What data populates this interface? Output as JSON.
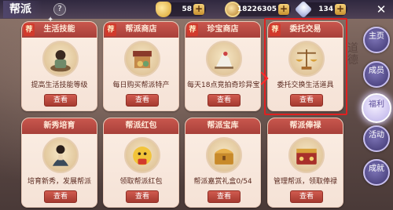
{
  "header": {
    "title": "帮派",
    "help": "?",
    "close": "✕"
  },
  "resources": [
    {
      "name": "gold-ingot",
      "value": "58",
      "plus": "+"
    },
    {
      "name": "coin",
      "value": "18226305",
      "plus": "+"
    },
    {
      "name": "gem",
      "value": "134",
      "plus": "+"
    }
  ],
  "cards": [
    {
      "title": "生活技能",
      "desc": "提高生活技能等级",
      "button": "查看",
      "recommended": "荐"
    },
    {
      "title": "帮派商店",
      "desc": "每日购买帮派特产",
      "button": "查看",
      "recommended": "荐"
    },
    {
      "title": "珍宝商店",
      "desc": "每天18点竞拍奇珍异宝",
      "button": "查看",
      "recommended": "荐"
    },
    {
      "title": "委托交易",
      "desc": "委托交换生活道具",
      "button": "查看",
      "recommended": "荐"
    },
    {
      "title": "新秀培育",
      "desc": "培育新秀，发展帮派",
      "button": "查看",
      "recommended": ""
    },
    {
      "title": "帮派红包",
      "desc": "领取帮派红包",
      "button": "查看",
      "recommended": ""
    },
    {
      "title": "帮派宝库",
      "desc": "帮派嘉赏礼盒0/54",
      "button": "查看",
      "recommended": ""
    },
    {
      "title": "帮派俸禄",
      "desc": "管理帮派，领取俸禄",
      "button": "查看",
      "recommended": ""
    }
  ],
  "side_menu": [
    {
      "label": "主页"
    },
    {
      "label": "成员"
    },
    {
      "label": "福利"
    },
    {
      "label": "活动"
    },
    {
      "label": "成就"
    }
  ],
  "background_text": "道德"
}
